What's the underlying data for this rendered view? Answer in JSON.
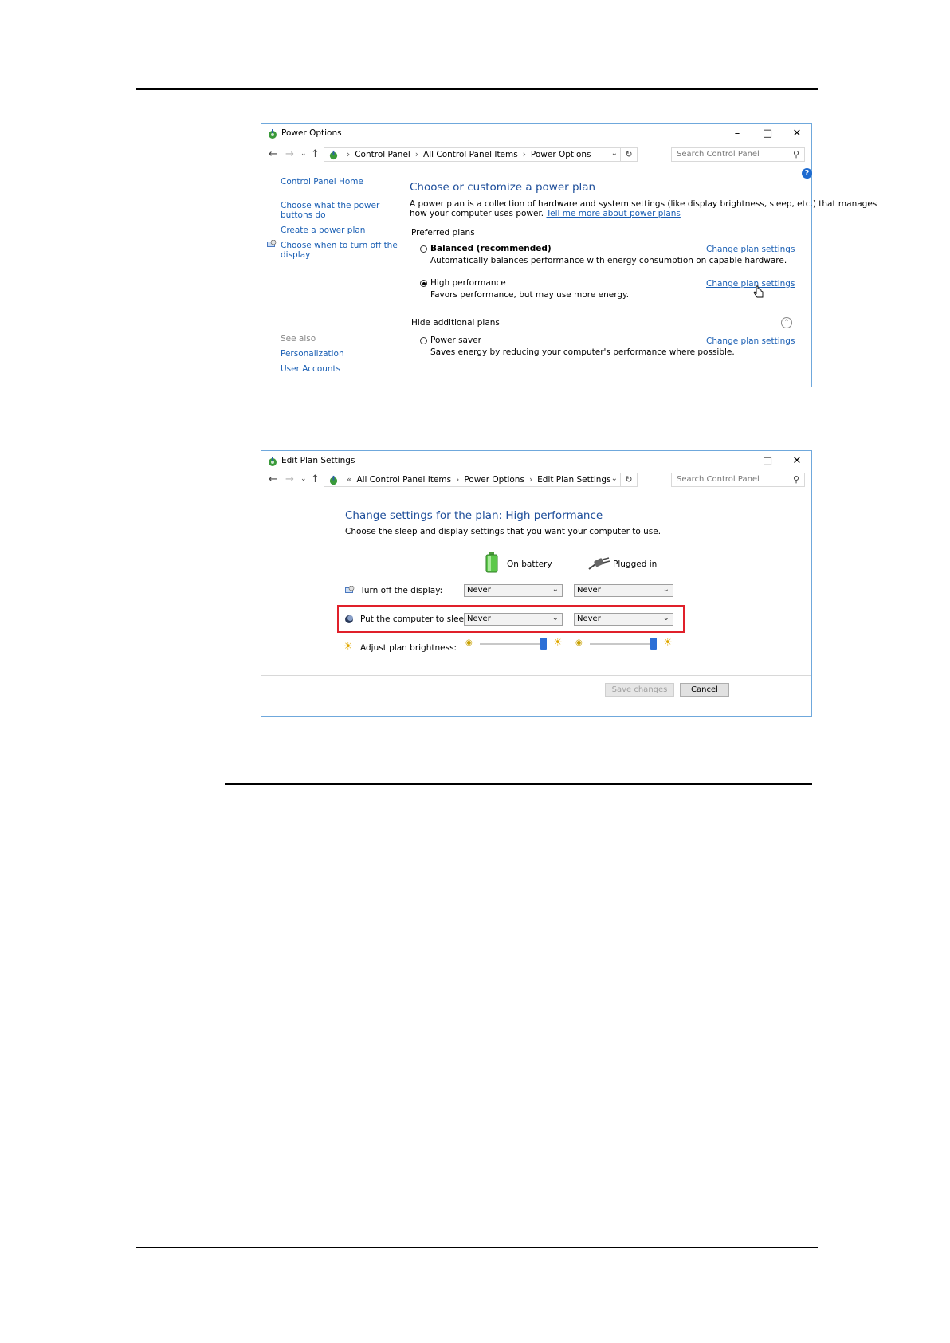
{
  "window1": {
    "title": "Power Options",
    "breadcrumb": [
      "Control Panel",
      "All Control Panel Items",
      "Power Options"
    ],
    "search_placeholder": "Search Control Panel",
    "sidebar": {
      "home": "Control Panel Home",
      "item1": "Choose what the power",
      "item1b": "buttons do",
      "item2": "Create a power plan",
      "item3": "Choose when to turn off the",
      "item3b": "display",
      "see_also": "See also",
      "personalization": "Personalization",
      "user_accounts": "User Accounts"
    },
    "heading": "Choose or customize a power plan",
    "desc1": "A power plan is a collection of hardware and system settings (like display brightness, sleep, etc.) that manages",
    "desc2": "how your computer uses power.",
    "desc_link": "Tell me more about power plans",
    "preferred_plans": "Preferred plans",
    "hide_additional": "Hide additional plans",
    "change_link": "Change plan settings",
    "plans": [
      {
        "name": "Balanced (recommended)",
        "desc": "Automatically balances performance with energy consumption on capable hardware.",
        "selected": false
      },
      {
        "name": "High performance",
        "desc": "Favors performance, but may use more energy.",
        "selected": true
      },
      {
        "name": "Power saver",
        "desc": "Saves energy by reducing your computer's performance where possible.",
        "selected": false
      }
    ]
  },
  "window2": {
    "title": "Edit Plan Settings",
    "breadcrumb": [
      "All Control Panel Items",
      "Power Options",
      "Edit Plan Settings"
    ],
    "search_placeholder": "Search Control Panel",
    "heading": "Change settings for the plan: High performance",
    "subheading": "Choose the sleep and display settings that you want your computer to use.",
    "on_battery": "On battery",
    "plugged_in": "Plugged in",
    "rows": [
      {
        "label": "Turn off the display:",
        "battery": "Never",
        "plugged": "Never"
      },
      {
        "label": "Put the computer to sleep:",
        "battery": "Never",
        "plugged": "Never"
      }
    ],
    "brightness_label": "Adjust plan brightness:",
    "brightness_battery": 1.0,
    "brightness_plugged": 1.0,
    "save_button": "Save changes",
    "cancel_button": "Cancel"
  },
  "colors": {
    "link": "#1a5fb4",
    "highlight_box": "#e0202a",
    "window_border": "#6fa8dc"
  }
}
